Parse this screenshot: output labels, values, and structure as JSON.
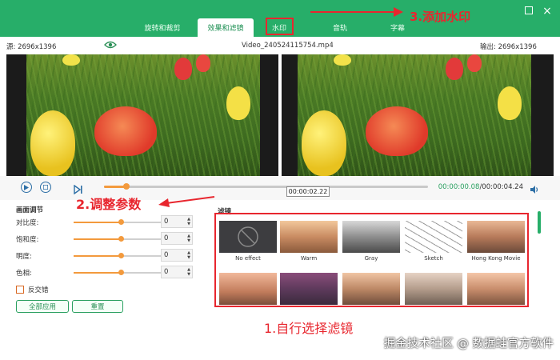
{
  "window": {
    "tabs": [
      {
        "label": "旋转和裁剪",
        "active": false
      },
      {
        "label": "效果和滤镜",
        "active": true
      },
      {
        "label": "水印",
        "active": false
      },
      {
        "label": "音轨",
        "active": false
      },
      {
        "label": "字幕",
        "active": false
      }
    ],
    "close_glyph": "×"
  },
  "infobar": {
    "source_label": "源: 2696x1396",
    "filename": "Video_240524115754.mp4",
    "output_label": "输出: 2696x1396"
  },
  "playback": {
    "current_time": "00:00:02.22",
    "elapsed": "00:00:00.08",
    "total": "/00:00:04.24",
    "progress": 0.07
  },
  "adjustments": {
    "title": "画面调节",
    "rows": [
      {
        "label": "对比度:",
        "value": "0",
        "level": 0.5
      },
      {
        "label": "饱和度:",
        "value": "0",
        "level": 0.5
      },
      {
        "label": "明度:",
        "value": "0",
        "level": 0.5
      },
      {
        "label": "色相:",
        "value": "0",
        "level": 0.5
      }
    ],
    "checkbox_label": "反交错",
    "apply_all": "全部应用",
    "reset": "重置"
  },
  "filters": {
    "title": "滤镜",
    "items": [
      {
        "label": "No effect"
      },
      {
        "label": "Warm"
      },
      {
        "label": "Gray"
      },
      {
        "label": "Sketch"
      },
      {
        "label": "Hong Kong Movie"
      },
      {
        "label": ""
      },
      {
        "label": ""
      },
      {
        "label": ""
      },
      {
        "label": ""
      },
      {
        "label": ""
      }
    ]
  },
  "annotations": {
    "step1": "1.自行选择滤镜",
    "step2": "2.调整参数",
    "step3": "3.添加水印"
  },
  "footer": {
    "watermark": "掘金技术社区 @ 数据蛙官方软件"
  },
  "colors": {
    "brand_green": "#27ae69",
    "accent_orange": "#f39a3d",
    "annotation_red": "#e8262e"
  },
  "icons": [
    "eye-icon",
    "play-icon",
    "stop-icon",
    "next-frame-icon",
    "volume-icon",
    "minimize-icon",
    "maximize-icon",
    "close-icon"
  ]
}
